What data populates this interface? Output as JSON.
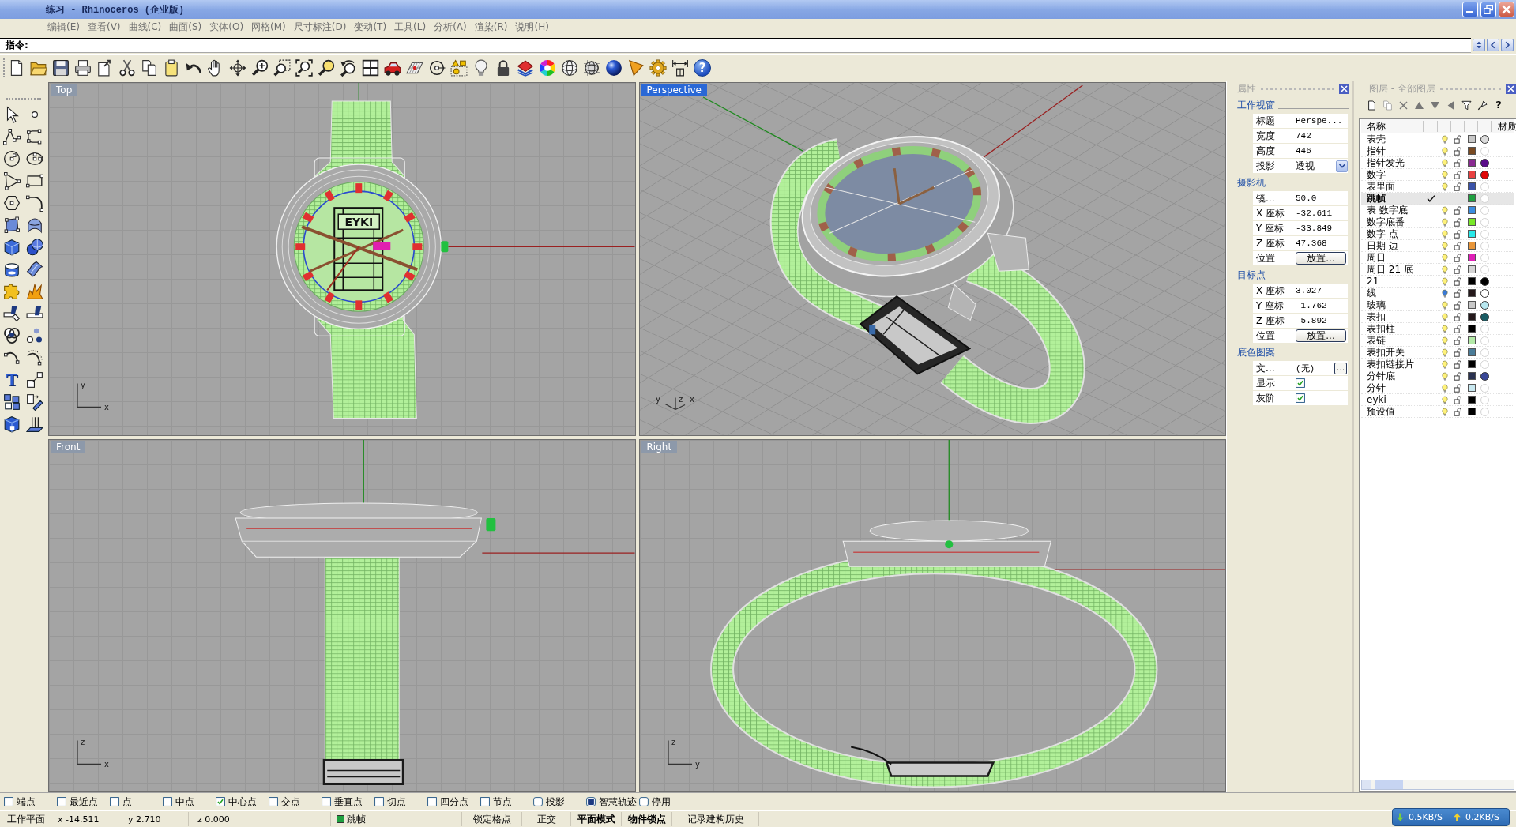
{
  "window": {
    "title": "练习 - Rhinoceros (企业版)"
  },
  "menu": [
    "编辑(E)",
    "查看(V)",
    "曲线(C)",
    "曲面(S)",
    "实体(O)",
    "网格(M)",
    "尺寸标注(D)",
    "变动(T)",
    "工具(L)",
    "分析(A)",
    "渲染(R)",
    "说明(H)"
  ],
  "command": {
    "prompt": "指令:"
  },
  "toolbar": {
    "help": "?"
  },
  "left_toolbar": {
    "text_tool": "T"
  },
  "viewports": [
    {
      "title": "Top",
      "selected": false,
      "kind": "top",
      "axis_labels": [
        "y",
        "x"
      ],
      "dial_text": "EYKI"
    },
    {
      "title": "Perspective",
      "selected": true,
      "kind": "perspective",
      "axis_labels": [
        "y",
        "z",
        "x"
      ]
    },
    {
      "title": "Front",
      "selected": false,
      "kind": "front",
      "axis_labels": [
        "z",
        "x"
      ]
    },
    {
      "title": "Right",
      "selected": false,
      "kind": "right",
      "axis_labels": [
        "z",
        "y"
      ]
    }
  ],
  "properties": {
    "title": "属性",
    "sections": [
      {
        "heading": "工作视窗",
        "rows": [
          {
            "kind": "text",
            "label": "标题",
            "value": "Perspe..."
          },
          {
            "kind": "text",
            "label": "宽度",
            "value": "742"
          },
          {
            "kind": "text",
            "label": "高度",
            "value": "446"
          },
          {
            "kind": "dropdown",
            "label": "投影",
            "value": "透视"
          }
        ]
      },
      {
        "heading": "摄影机",
        "rows": [
          {
            "kind": "text",
            "label": "镜...",
            "value": "50.0"
          },
          {
            "kind": "text",
            "label": "X 座标",
            "value": "-32.611"
          },
          {
            "kind": "text",
            "label": "Y 座标",
            "value": "-33.849"
          },
          {
            "kind": "text",
            "label": "Z 座标",
            "value": "47.368"
          },
          {
            "kind": "button",
            "label": "位置",
            "value": "放置..."
          }
        ]
      },
      {
        "heading": "目标点",
        "rows": [
          {
            "kind": "text",
            "label": "X 座标",
            "value": "3.027"
          },
          {
            "kind": "text",
            "label": "Y 座标",
            "value": "-1.762"
          },
          {
            "kind": "text",
            "label": "Z 座标",
            "value": "-5.892"
          },
          {
            "kind": "button",
            "label": "位置",
            "value": "放置..."
          }
        ]
      },
      {
        "heading": "底色图案",
        "rows": [
          {
            "kind": "file",
            "label": "文...",
            "value": "(无)",
            "button": "..."
          },
          {
            "kind": "checkbox",
            "label": "显示",
            "checked": true
          },
          {
            "kind": "checkbox",
            "label": "灰阶",
            "checked": true
          }
        ]
      }
    ]
  },
  "layers": {
    "title": "图层 - 全部图层",
    "help": "?",
    "name_column": "名称",
    "material_column": "材质",
    "rows": [
      {
        "name": "表壳",
        "current": false,
        "visible": true,
        "locked": false,
        "color": "#c8c8c8",
        "material": {
          "color": "#dcdcdc"
        }
      },
      {
        "name": "指针",
        "current": false,
        "visible": true,
        "locked": false,
        "color": "#7a4a22"
      },
      {
        "name": "指针发光",
        "current": false,
        "visible": true,
        "locked": false,
        "color": "#8a2a92",
        "material": {
          "color": "#5a0c8a"
        }
      },
      {
        "name": "数字",
        "current": false,
        "visible": true,
        "locked": false,
        "color": "#e84040",
        "material": {
          "color": "#e00808"
        }
      },
      {
        "name": "表里面",
        "current": false,
        "visible": true,
        "locked": false,
        "color": "#3a52a8"
      },
      {
        "name": "跳帧",
        "current": true,
        "color": "#1fa040"
      },
      {
        "name": "表 数字底",
        "current": false,
        "visible": true,
        "locked": false,
        "color": "#3a8ce0"
      },
      {
        "name": "数字底番",
        "current": false,
        "visible": true,
        "locked": false,
        "color": "#78e828"
      },
      {
        "name": "数字 点",
        "current": false,
        "visible": true,
        "locked": false,
        "color": "#28e8e8"
      },
      {
        "name": "日期 边",
        "current": false,
        "visible": true,
        "locked": false,
        "color": "#e8963a"
      },
      {
        "name": "周日",
        "current": false,
        "visible": true,
        "locked": false,
        "color": "#e020b8"
      },
      {
        "name": "周日 21 底",
        "current": false,
        "visible": true,
        "locked": false,
        "color": "#d4d4d4"
      },
      {
        "name": "21",
        "current": false,
        "visible": true,
        "locked": false,
        "color": "#000000",
        "material": {
          "color": "#000000"
        }
      },
      {
        "name": "线",
        "current": false,
        "visible": true,
        "locked": false,
        "bulb_highlighted": true,
        "color": "#24181a",
        "material": {
          "color": "#ffffff"
        }
      },
      {
        "name": "玻璃",
        "current": false,
        "visible": true,
        "locked": false,
        "color": "#c8c8c8",
        "material": {
          "color": "#b8e8f0"
        }
      },
      {
        "name": "表扣",
        "current": false,
        "visible": true,
        "locked": false,
        "color": "#24181a",
        "material": {
          "color": "#1a5c64"
        }
      },
      {
        "name": "表扣柱",
        "current": false,
        "visible": true,
        "locked": false,
        "color": "#000000"
      },
      {
        "name": "表链",
        "current": false,
        "visible": true,
        "locked": false,
        "color": "#b4eaa8"
      },
      {
        "name": "表扣开关",
        "current": false,
        "visible": true,
        "locked": false,
        "color": "#4a7c98"
      },
      {
        "name": "表扣链接片",
        "current": false,
        "visible": true,
        "locked": false,
        "color": "#000000"
      },
      {
        "name": "分针底",
        "current": false,
        "visible": true,
        "locked": false,
        "color": "#2a3250",
        "material": {
          "color": "#3a4898"
        }
      },
      {
        "name": "分针",
        "current": false,
        "visible": true,
        "locked": false,
        "color": "#c8e8f0"
      },
      {
        "name": "eyki",
        "current": false,
        "visible": true,
        "locked": false,
        "color": "#000000"
      },
      {
        "name": "预设值",
        "current": false,
        "visible": true,
        "locked": false,
        "color": "#000000"
      }
    ]
  },
  "osnaps": [
    {
      "label": "端点",
      "kind": "check",
      "checked": false
    },
    {
      "label": "最近点",
      "kind": "check",
      "checked": false
    },
    {
      "label": "点",
      "kind": "check",
      "checked": false
    },
    {
      "label": "中点",
      "kind": "check",
      "checked": false
    },
    {
      "label": "中心点",
      "kind": "check",
      "checked": true
    },
    {
      "label": "交点",
      "kind": "check",
      "checked": false
    },
    {
      "label": "垂直点",
      "kind": "check",
      "checked": false
    },
    {
      "label": "切点",
      "kind": "check",
      "checked": false
    },
    {
      "label": "四分点",
      "kind": "check",
      "checked": false
    },
    {
      "label": "节点",
      "kind": "check",
      "checked": false
    },
    {
      "label": "投影",
      "kind": "toggle",
      "checked": false
    },
    {
      "label": "智慧轨迹",
      "kind": "toggle",
      "checked": true
    },
    {
      "label": "停用",
      "kind": "toggle",
      "checked": false
    }
  ],
  "status_bar": {
    "cplane": "工作平面",
    "x": "x -14.511",
    "y": "y 2.710",
    "z": "z 0.000",
    "layer": {
      "name": "跳帧",
      "color": "#1fa040"
    },
    "toggles": [
      {
        "label": "锁定格点",
        "on": false
      },
      {
        "label": "正交",
        "on": false
      },
      {
        "label": "平面模式",
        "on": true
      },
      {
        "label": "物件锁点",
        "on": true
      },
      {
        "label": "记录建构历史",
        "on": false
      }
    ]
  },
  "network": {
    "download": "0.5KB/S",
    "upload": "0.2KB/S"
  }
}
